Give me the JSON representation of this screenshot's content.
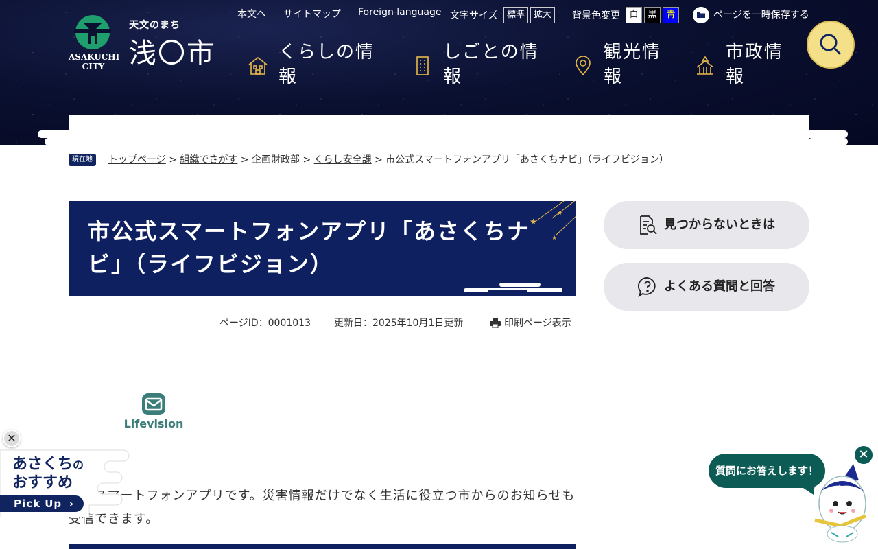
{
  "header": {
    "logo_tagline": "天文のまち",
    "logo_name": "浅〇市",
    "logo_en": "ASAKUCHI CITY",
    "utility_links": {
      "main_text": "本文へ",
      "sitemap": "サイトマップ",
      "foreign": "Foreign language"
    },
    "font_size_label": "文字サイズ",
    "font_size_options": [
      "標準",
      "拡大"
    ],
    "bg_color_label": "背景色変更",
    "bg_color_options": [
      {
        "label": "白",
        "bg": "#ffffff",
        "fg": "#333333"
      },
      {
        "label": "黒",
        "bg": "#000000",
        "fg": "#ffffff"
      },
      {
        "label": "青",
        "bg": "#0000ff",
        "fg": "#ffff00"
      }
    ],
    "save_label": "ページを一時保存する",
    "nav": [
      {
        "label": "くらしの情報",
        "icon": "house-icon"
      },
      {
        "label": "しごとの情報",
        "icon": "building-icon"
      },
      {
        "label": "観光情報",
        "icon": "map-pin-icon"
      },
      {
        "label": "市政情報",
        "icon": "city-hall-icon"
      }
    ],
    "search_icon": "search-icon"
  },
  "breadcrumb": {
    "badge": "現在地",
    "items": [
      {
        "label": "トップページ",
        "link": true
      },
      {
        "label": "組織でさがす",
        "link": true
      },
      {
        "label": "企画財政部",
        "link": false
      },
      {
        "label": "くらし安全課",
        "link": true
      },
      {
        "label": "市公式スマートフォンアプリ「あさくちナビ」（ライフビジョン）",
        "link": false
      }
    ],
    "separator": ">"
  },
  "page": {
    "title": "市公式スマートフォンアプリ「あさくちナビ」（ライフビジョン）",
    "page_id": "ページID：0001013",
    "updated": "更新日：2025年10月1日更新",
    "print_label": "印刷ページ表示",
    "app_image_name": "Lifevision",
    "body_text": "市のスマートフォンアプリです。災害情報だけでなく生活に役立つ市からのお知らせも受信できます。"
  },
  "side": {
    "not_found": "見つからないときは",
    "faq": "よくある質問と回答"
  },
  "pickup": {
    "title_main": "あさくち",
    "title_particle": "の",
    "title_second": "おすすめ",
    "button": "Pick Up"
  },
  "chatbot": {
    "bubble": "質問にお答えします！"
  },
  "colors": {
    "navy": "#10245f",
    "accent_yellow": "#f5e08a",
    "chat_green": "#0c5b55",
    "logo_green": "#1f9e6e"
  }
}
